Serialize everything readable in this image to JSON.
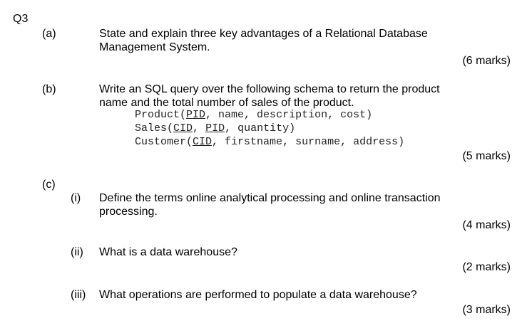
{
  "question": "Q3",
  "parts": {
    "a": {
      "label": "(a)",
      "line1": "State and explain three key advantages of a Relational Database",
      "line2": "Management System.",
      "marks": "(6 marks)"
    },
    "b": {
      "label": "(b)",
      "line1": "Write an SQL query over the following schema to return the product",
      "line2": "name and the total number of sales of the product.",
      "marks": "(5 marks)",
      "schema": {
        "product": {
          "table": "Product",
          "open": "(",
          "pk": "PID",
          "rest": ", name, description, cost)"
        },
        "sales": {
          "table": "Sales",
          "open": "(",
          "k1": "CID",
          "sep": ", ",
          "k2": "PID",
          "rest": ", quantity)"
        },
        "customer": {
          "table": "Customer",
          "open": "(",
          "pk": "CID",
          "rest": ", firstname, surname, address)"
        }
      }
    },
    "c": {
      "label": "(c)",
      "i": {
        "label": "(i)",
        "line1": "Define the terms online analytical processing and online transaction",
        "line2": "processing.",
        "marks": "(4 marks)"
      },
      "ii": {
        "label": "(ii)",
        "line1": "What is a data warehouse?",
        "marks": "(2 marks)"
      },
      "iii": {
        "label": "(iii)",
        "line1": "What operations are performed to populate a data warehouse?",
        "marks": "(3 marks)"
      }
    }
  }
}
